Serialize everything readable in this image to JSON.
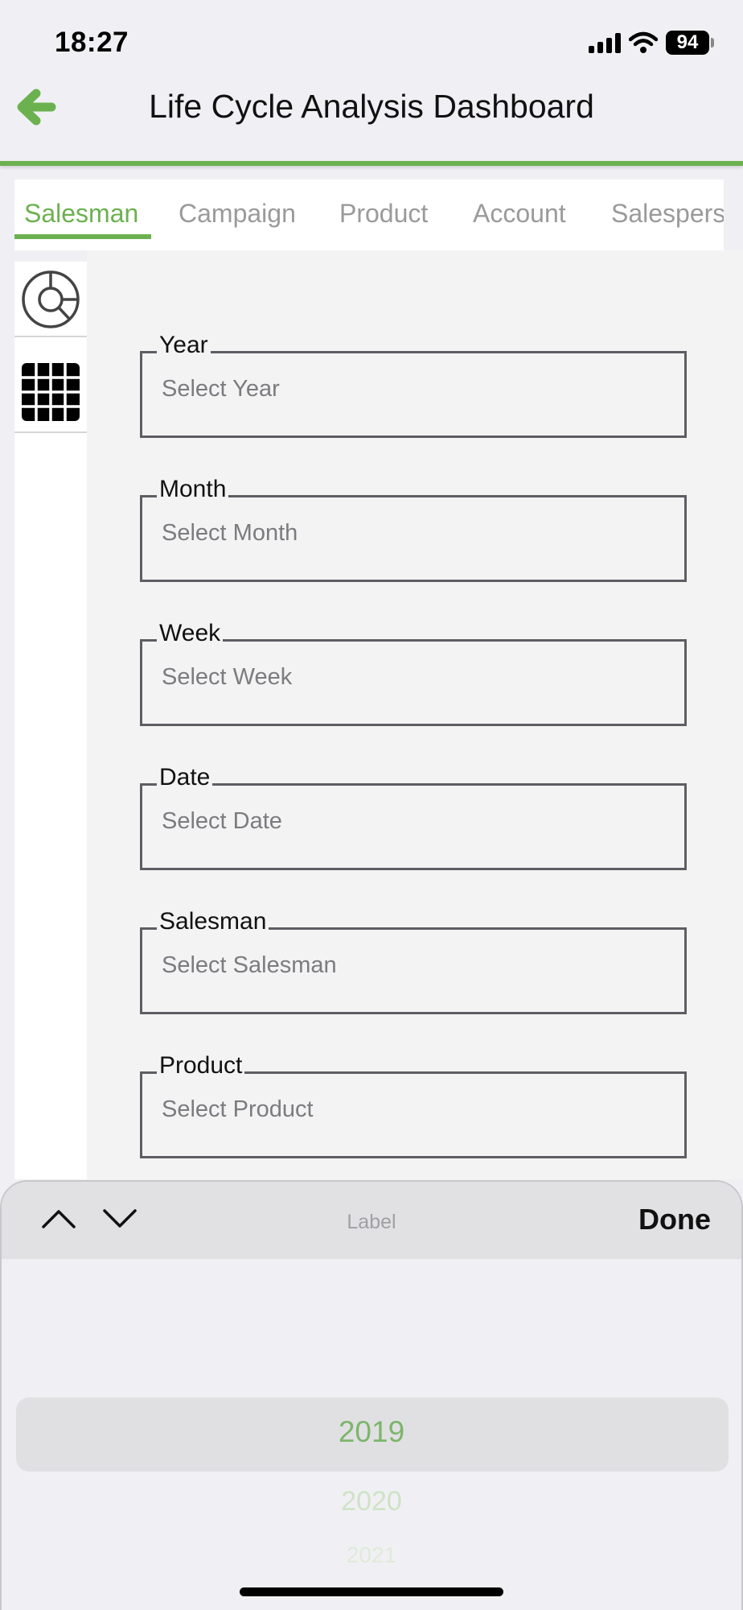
{
  "status_bar": {
    "time": "18:27",
    "battery": "94",
    "icons": [
      "signal-icon",
      "wifi-icon",
      "battery-icon"
    ]
  },
  "header": {
    "title": "Life Cycle Analysis Dashboard",
    "back_icon": "arrow-left-icon"
  },
  "tabs": [
    "Salesman",
    "Campaign",
    "Product",
    "Account",
    "Salespers"
  ],
  "active_tab": "Salesman",
  "sidebar": {
    "items": [
      {
        "icon": "pie-chart-icon"
      },
      {
        "icon": "grid-table-icon"
      }
    ]
  },
  "filters": [
    {
      "label": "Year",
      "placeholder": "Select Year"
    },
    {
      "label": "Month",
      "placeholder": "Select Month"
    },
    {
      "label": "Week",
      "placeholder": "Select Week"
    },
    {
      "label": "Date",
      "placeholder": "Select Date"
    },
    {
      "label": "Salesman",
      "placeholder": "Select Salesman"
    },
    {
      "label": "Product",
      "placeholder": "Select Product"
    }
  ],
  "picker": {
    "label": "Label",
    "done": "Done",
    "options": [
      "2019",
      "2020",
      "2021"
    ],
    "selected": "2019"
  },
  "colors": {
    "accent": "#6cb14f",
    "background": "#f0f0f4",
    "field_border": "#5d5d63",
    "placeholder": "#7b7b80"
  }
}
